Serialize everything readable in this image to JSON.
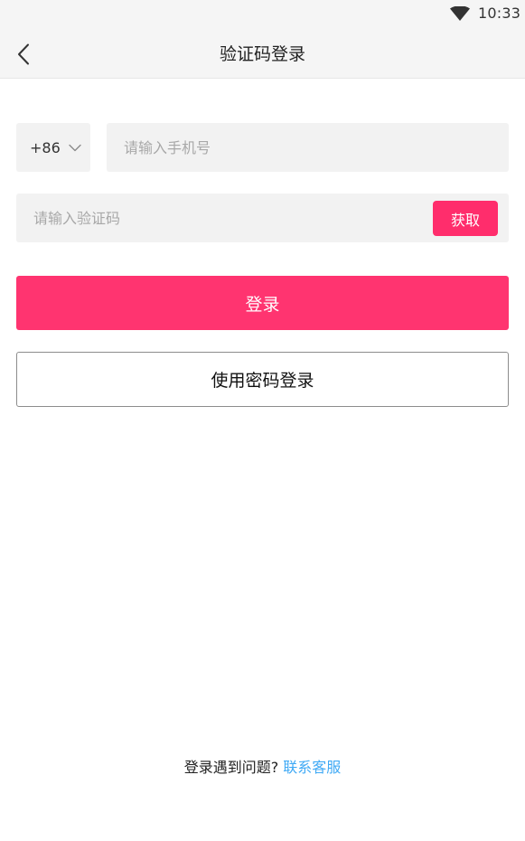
{
  "status_bar": {
    "time": "10:33",
    "icons": [
      "wifi-icon"
    ]
  },
  "header": {
    "title": "验证码登录",
    "back_icon": "chevron-left-icon"
  },
  "form": {
    "country_code": "+86",
    "country_chevron_icon": "chevron-down-icon",
    "phone": {
      "value": "",
      "placeholder": "请输入手机号"
    },
    "verification": {
      "value": "",
      "placeholder": "请输入验证码",
      "get_code_label": "获取"
    },
    "login_label": "登录",
    "password_login_label": "使用密码登录"
  },
  "footer": {
    "help_text": "登录遇到问题?",
    "help_link": "联系客服"
  },
  "colors": {
    "accent": "#ff3470",
    "get_code_bg": "#ff2d6c",
    "link": "#3fa9f5",
    "input_bg": "#f2f2f2",
    "bar_bg": "#f5f5f5"
  }
}
